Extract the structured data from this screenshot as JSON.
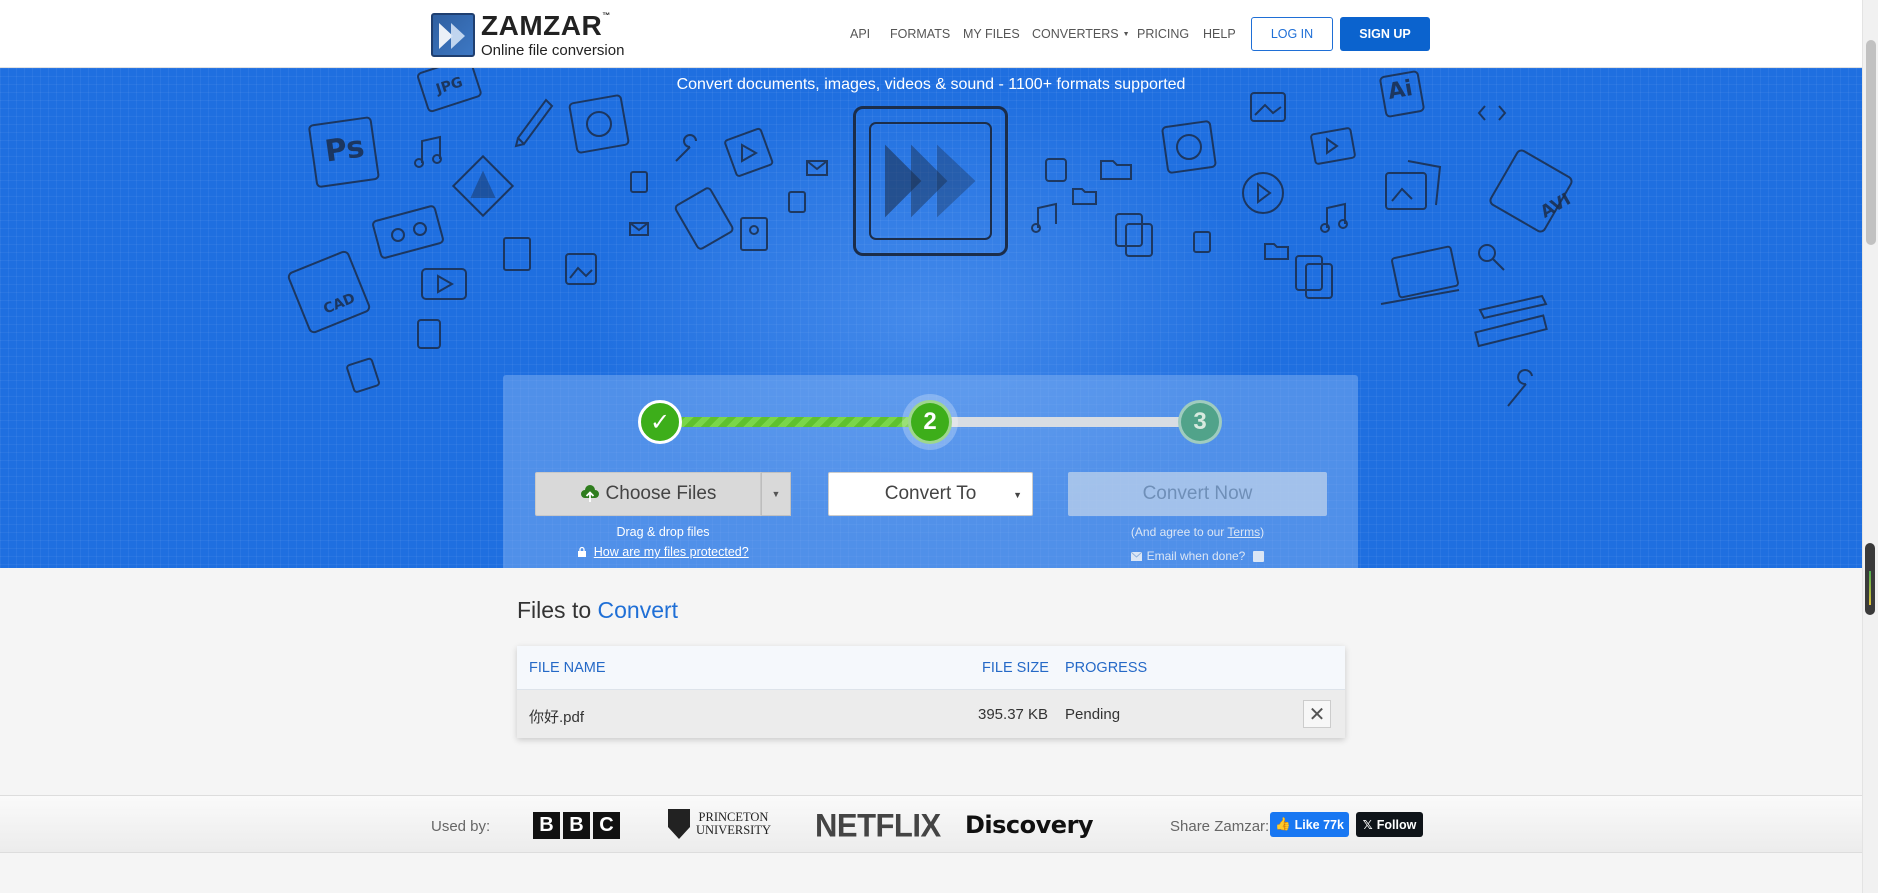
{
  "header": {
    "logo_name": "ZAMZAR",
    "logo_tm": "™",
    "logo_subtitle": "Online file conversion",
    "nav": [
      "API",
      "FORMATS",
      "MY FILES",
      "CONVERTERS",
      "PRICING",
      "HELP"
    ],
    "login_label": "LOG IN",
    "signup_label": "SIGN UP"
  },
  "hero": {
    "tagline": "Convert documents, images, videos & sound - 1100+ formats supported",
    "doodle_labels": [
      "JPG",
      "Ps",
      "Ai",
      "AVI",
      "CAD"
    ]
  },
  "converter": {
    "steps": [
      {
        "label": "✓",
        "state": "done"
      },
      {
        "label": "2",
        "state": "active"
      },
      {
        "label": "3",
        "state": "pending"
      }
    ],
    "step_progress": 0.5,
    "choose_files_label": "Choose Files",
    "drag_drop_text": "Drag & drop files",
    "protected_link": "How are my files protected?",
    "convert_to_label": "Convert To",
    "convert_now_label": "Convert Now",
    "agree_prefix": "(And agree to our ",
    "agree_terms": "Terms",
    "agree_suffix": ")",
    "email_label": "Email when done?"
  },
  "files": {
    "title_prefix": "Files to",
    "title_accent": "Convert",
    "columns": {
      "name": "FILE NAME",
      "size": "FILE SIZE",
      "progress": "PROGRESS"
    },
    "rows": [
      {
        "name": "你好.pdf",
        "size": "395.37 KB",
        "progress": "Pending"
      }
    ]
  },
  "usedby": {
    "label": "Used by:",
    "logos": {
      "bbc": [
        "B",
        "B",
        "C"
      ],
      "princeton_line1": "PRINCETON",
      "princeton_line2": "UNIVERSITY",
      "netflix": "NETFLIX",
      "discovery": "Discovery"
    },
    "share_label": "Share Zamzar:",
    "fb_like": "Like 77k",
    "x_follow": "Follow"
  },
  "colors": {
    "brand_blue": "#1f6fe0",
    "button_blue": "#0b63ce",
    "step_green": "#3dae1a",
    "link_blue": "#1f6fd6"
  }
}
